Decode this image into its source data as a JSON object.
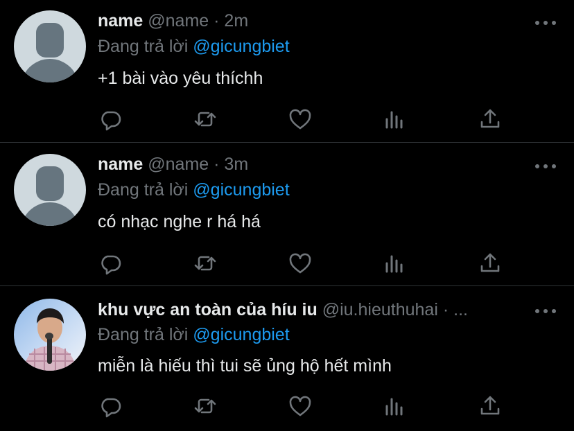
{
  "tweets": [
    {
      "name": "name",
      "handle": "@name",
      "dot": "·",
      "time": "2m",
      "reply_prefix": "Đang trả lời",
      "reply_to": "@gicungbiet",
      "text": "+1 bài vào yêu thíchh",
      "avatar": "default-avatar"
    },
    {
      "name": "name",
      "handle": "@name",
      "dot": "·",
      "time": "3m",
      "reply_prefix": "Đang trả lời",
      "reply_to": "@gicungbiet",
      "text": "có nhạc nghe r há há",
      "avatar": "default-avatar"
    },
    {
      "name": "khu vực an toàn của híu iu",
      "handle": "@iu.hieuthuhai",
      "dot": "·",
      "time": "...",
      "reply_prefix": "Đang trả lời",
      "reply_to": "@gicungbiet",
      "text": "miễn là hiếu thì tui sẽ ủng hộ hết mình",
      "avatar": "photo-avatar"
    }
  ],
  "icons": [
    "reply-icon",
    "retweet-icon",
    "like-icon",
    "analytics-icon",
    "share-icon",
    "more-icon"
  ],
  "colors": {
    "background": "#000000",
    "text_primary": "#e7e9ea",
    "text_secondary": "#71767b",
    "accent": "#1d9bf0",
    "divider": "#2f3336"
  }
}
